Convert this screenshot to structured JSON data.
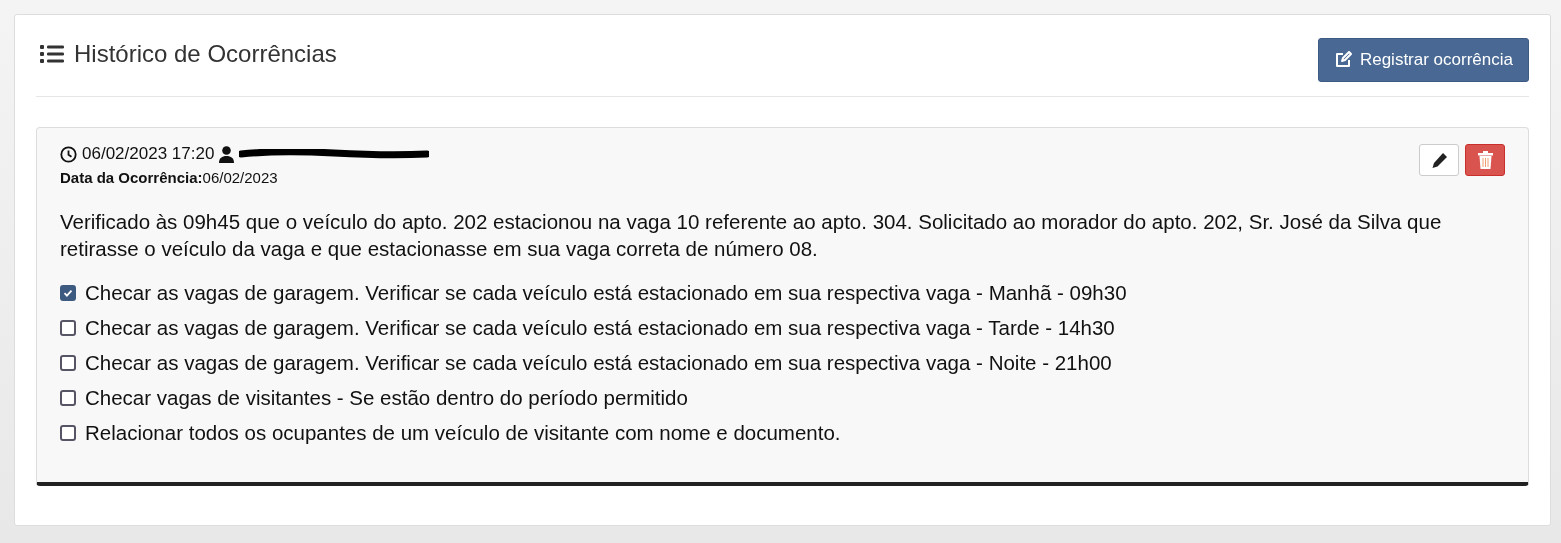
{
  "header": {
    "title": "Histórico de Ocorrências",
    "button": "Registrar ocorrência"
  },
  "occurrence": {
    "timestamp": "06/02/2023 17:20",
    "user_redacted": true,
    "date_label": "Data da Ocorrência:",
    "date": "06/02/2023",
    "description": "Verificado às 09h45 que o veículo do apto. 202 estacionou na vaga 10 referente ao apto. 304. Solicitado ao morador do apto. 202, Sr. José da Silva que retirasse o veículo da vaga e que estacionasse em sua vaga correta de número 08.",
    "checklist": [
      {
        "label": "Checar as vagas de garagem. Verificar se cada veículo está estacionado em sua respectiva vaga - Manhã - 09h30",
        "checked": true
      },
      {
        "label": "Checar as vagas de garagem. Verificar se cada veículo está estacionado em sua respectiva vaga - Tarde - 14h30",
        "checked": false
      },
      {
        "label": "Checar as vagas de garagem. Verificar se cada veículo está estacionado em sua respectiva vaga - Noite - 21h00",
        "checked": false
      },
      {
        "label": "Checar vagas de visitantes - Se estão dentro do período permitido",
        "checked": false
      },
      {
        "label": "Relacionar todos os ocupantes de um veículo de visitante com nome e documento.",
        "checked": false
      }
    ]
  }
}
